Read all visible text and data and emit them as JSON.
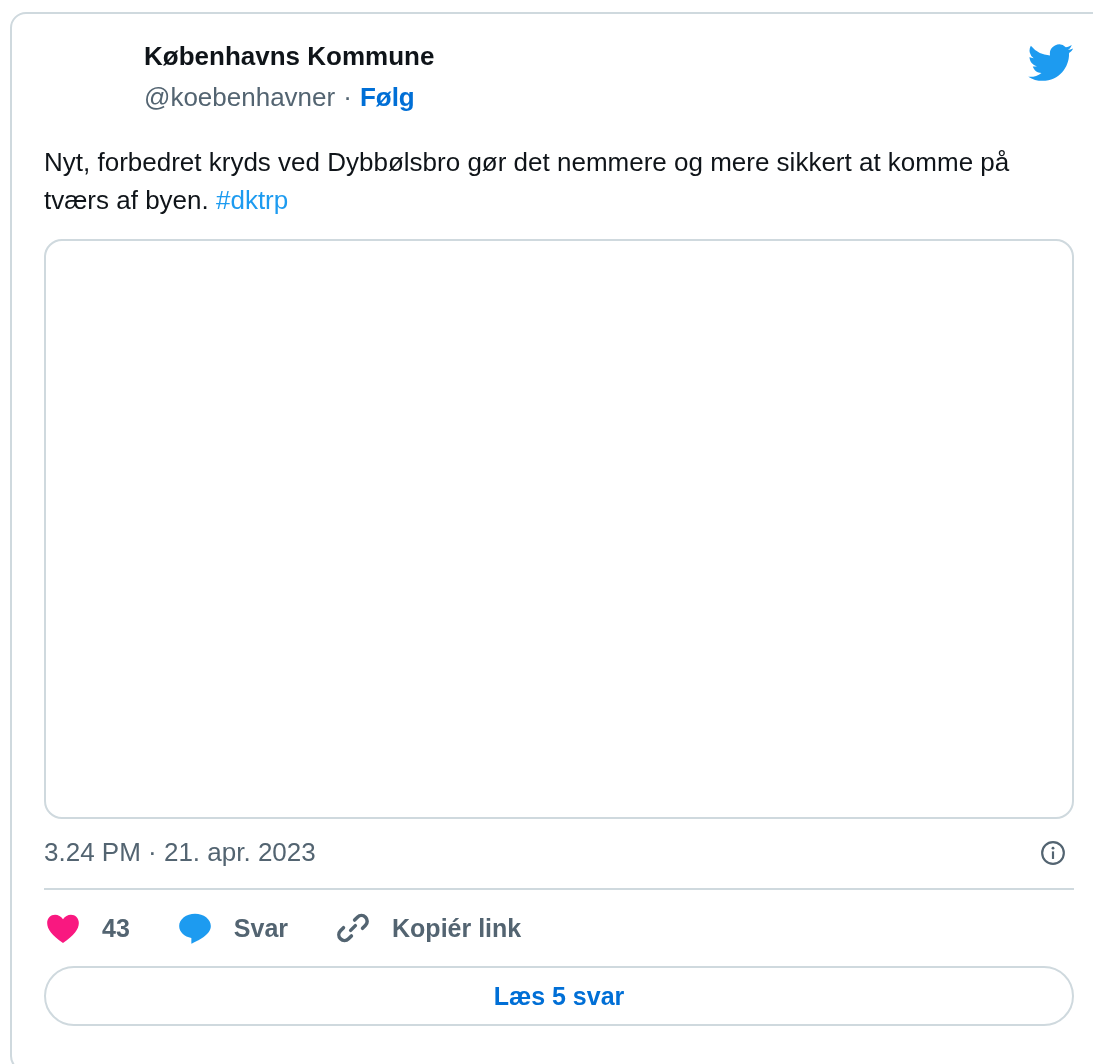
{
  "author": {
    "name": "Københavns Kommune",
    "handle": "@koebenhavner",
    "separator": "·",
    "follow": "Følg"
  },
  "tweet": {
    "text": "Nyt, forbedret kryds ved Dybbølsbro gør det nemmere og mere sikkert at komme på tværs af byen.",
    "hashtag": "#dktrp"
  },
  "timestamp": "3.24 PM · 21. apr. 2023",
  "actions": [
    {
      "kind": "like",
      "label": "43"
    },
    {
      "kind": "reply",
      "label": "Svar"
    },
    {
      "kind": "link",
      "label": "Kopiér link"
    }
  ],
  "read_replies": "Læs 5 svar"
}
